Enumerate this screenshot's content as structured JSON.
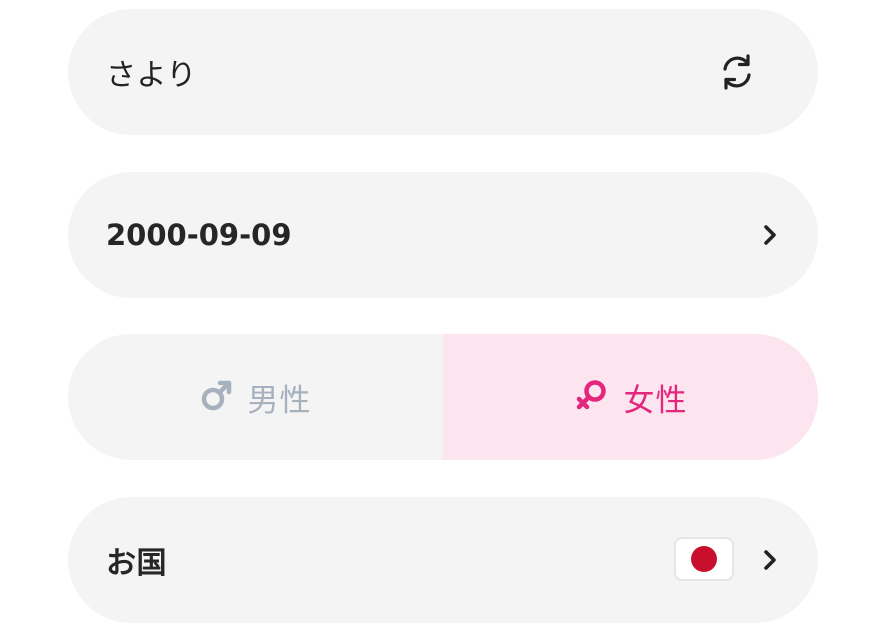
{
  "name_field": {
    "value": "さより",
    "action_icon": "refresh-icon"
  },
  "birthdate_field": {
    "value": "2000-09-09",
    "action_icon": "chevron-right-icon"
  },
  "gender": {
    "options": [
      {
        "label": "男性",
        "icon": "male-icon",
        "selected": false
      },
      {
        "label": "女性",
        "icon": "female-icon",
        "selected": true
      }
    ],
    "colors": {
      "unselected": "#a7b1be",
      "selected_text": "#e4267d",
      "selected_bg": "#fde5f0"
    }
  },
  "country_field": {
    "label": "お国",
    "flag": "japan-flag-icon",
    "action_icon": "chevron-right-icon"
  },
  "colors": {
    "pill_background": "#f4f4f4",
    "text": "#222222"
  }
}
